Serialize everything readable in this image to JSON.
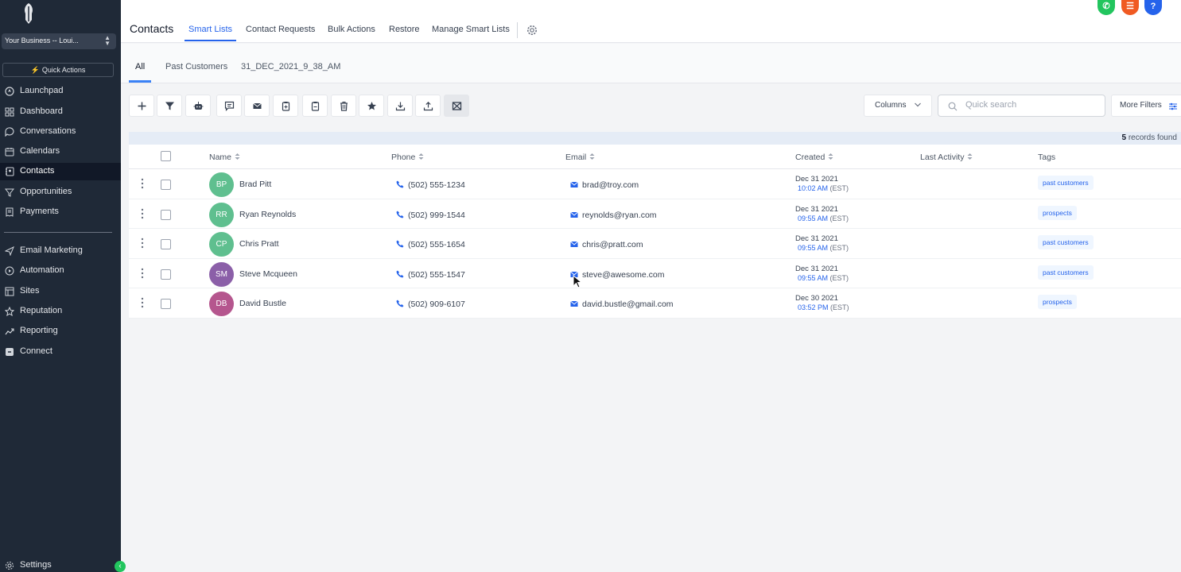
{
  "sidebar": {
    "business": "Your Business -- Loui...",
    "quick_actions": "Quick Actions",
    "items": [
      {
        "label": "Launchpad",
        "icon": "rocket-icon"
      },
      {
        "label": "Dashboard",
        "icon": "dashboard-icon"
      },
      {
        "label": "Conversations",
        "icon": "chat-icon"
      },
      {
        "label": "Calendars",
        "icon": "calendar-icon"
      },
      {
        "label": "Contacts",
        "icon": "contacts-icon",
        "active": true
      },
      {
        "label": "Opportunities",
        "icon": "funnel-icon"
      },
      {
        "label": "Payments",
        "icon": "receipt-icon"
      },
      {
        "label": "Email Marketing",
        "icon": "send-icon"
      },
      {
        "label": "Automation",
        "icon": "automation-icon"
      },
      {
        "label": "Sites",
        "icon": "globe-icon"
      },
      {
        "label": "Reputation",
        "icon": "star-icon"
      },
      {
        "label": "Reporting",
        "icon": "chart-icon"
      },
      {
        "label": "Connect",
        "icon": "connect-icon"
      }
    ],
    "settings": "Settings"
  },
  "header": {
    "title": "Contacts",
    "tabs": [
      "Smart Lists",
      "Contact Requests",
      "Bulk Actions",
      "Restore",
      "Manage Smart Lists"
    ],
    "active_tab": "Smart Lists"
  },
  "subtabs": [
    "All",
    "Past Customers",
    "31_DEC_2021_9_38_AM"
  ],
  "toolbar": {
    "columns_label": "Columns",
    "search_placeholder": "Quick search",
    "more_filters": "More Filters"
  },
  "records": {
    "count": "5",
    "label": "records found"
  },
  "table": {
    "headers": [
      "Name",
      "Phone",
      "Email",
      "Created",
      "Last Activity",
      "Tags"
    ],
    "rows": [
      {
        "initials": "BP",
        "name": "Brad Pitt",
        "phone": "(502) 555-1234",
        "email": "brad@troy.com",
        "date": "Dec 31 2021",
        "time": "10:02 AM",
        "tz": "(EST)",
        "tag": "past customers",
        "avatar_color": "#5fbf8f"
      },
      {
        "initials": "RR",
        "name": "Ryan Reynolds",
        "phone": "(502) 999-1544",
        "email": "reynolds@ryan.com",
        "date": "Dec 31 2021",
        "time": "09:55 AM",
        "tz": "(EST)",
        "tag": "prospects",
        "avatar_color": "#5fbf8f"
      },
      {
        "initials": "CP",
        "name": "Chris Pratt",
        "phone": "(502) 555-1654",
        "email": "chris@pratt.com",
        "date": "Dec 31 2021",
        "time": "09:55 AM",
        "tz": "(EST)",
        "tag": "past customers",
        "avatar_color": "#5fbf8f"
      },
      {
        "initials": "SM",
        "name": "Steve Mcqueen",
        "phone": "(502) 555-1547",
        "email": "steve@awesome.com",
        "date": "Dec 31 2021",
        "time": "09:55 AM",
        "tz": "(EST)",
        "tag": "past customers",
        "avatar_color": "#8b5fa8"
      },
      {
        "initials": "DB",
        "name": "David Bustle",
        "phone": "(502) 909-6107",
        "email": "david.bustle@gmail.com",
        "date": "Dec 30 2021",
        "time": "03:52 PM",
        "tz": "(EST)",
        "tag": "prospects",
        "avatar_color": "#b5568e"
      }
    ]
  },
  "colors": {
    "accent": "#2563eb",
    "sidebar_bg": "#1f2937",
    "phone_btn": "#22c55e",
    "list_btn": "#f05a22",
    "help_btn": "#2563eb"
  }
}
